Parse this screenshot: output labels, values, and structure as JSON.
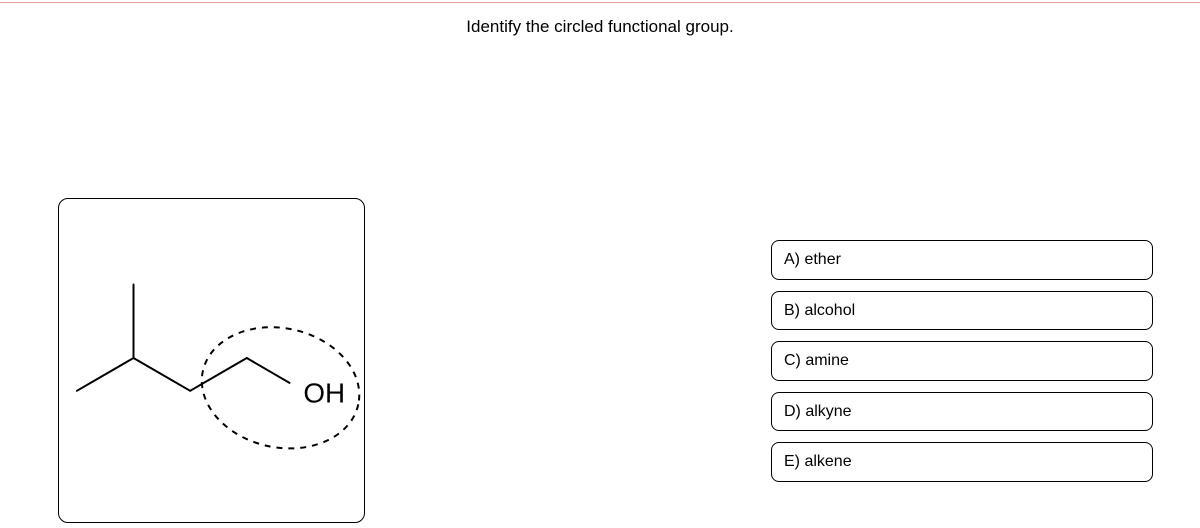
{
  "question": {
    "title": "Identify the circled functional group."
  },
  "molecule": {
    "label": "OH"
  },
  "options": [
    {
      "label": "A) ether"
    },
    {
      "label": "B) alcohol"
    },
    {
      "label": "C) amine"
    },
    {
      "label": "D) alkyne"
    },
    {
      "label": "E) alkene"
    }
  ]
}
